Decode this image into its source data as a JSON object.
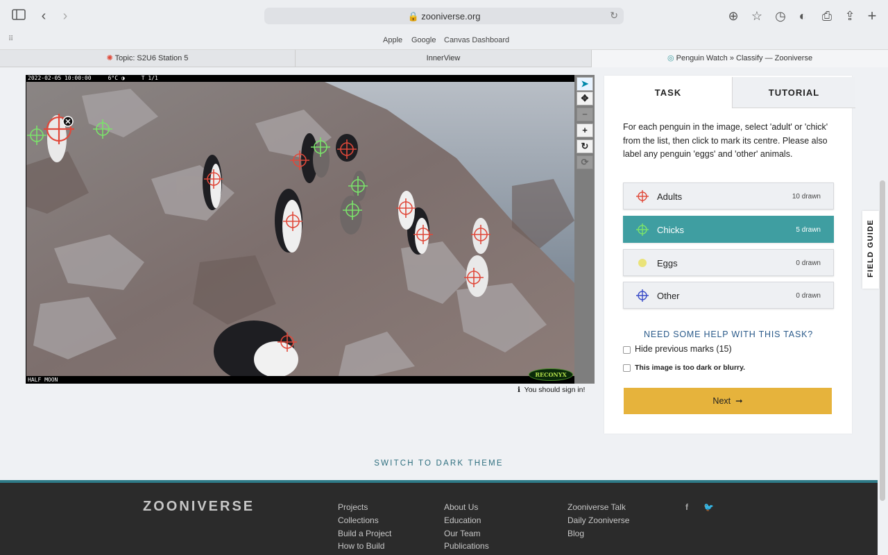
{
  "browser": {
    "url": "zooniverse.org",
    "favorites": [
      "Apple",
      "Google",
      "Canvas Dashboard"
    ],
    "tabs": [
      {
        "label": "Topic: S2U6 Station 5",
        "active": false
      },
      {
        "label": "InnerView",
        "active": false
      },
      {
        "label": "Penguin Watch » Classify — Zooniverse",
        "active": true
      }
    ]
  },
  "viewer": {
    "timestamp": "2022-02-05 10:00:00",
    "temperature": "6°C",
    "frame": "T 1/1",
    "location": "HALF MOON",
    "camera_brand": "RECONYX",
    "sign_in_notice": "You should sign in!",
    "tools": [
      "pointer-icon",
      "move-icon",
      "zoom-out-icon",
      "zoom-in-icon",
      "rotate-icon",
      "reset-icon"
    ]
  },
  "task_panel": {
    "tabs": {
      "task": "TASK",
      "tutorial": "TUTORIAL"
    },
    "instructions": "For each penguin in the image, select 'adult' or 'chick' from the list, then click to mark its centre. Please also label any penguin 'eggs' and 'other' animals.",
    "tools": [
      {
        "name": "Adults",
        "count": "10 drawn",
        "color": "#e04a3a",
        "selected": false
      },
      {
        "name": "Chicks",
        "count": "5 drawn",
        "color": "#7be36b",
        "selected": true
      },
      {
        "name": "Eggs",
        "count": "0 drawn",
        "color": "#e8e05a",
        "selected": false
      },
      {
        "name": "Other",
        "count": "0 drawn",
        "color": "#3a4cc8",
        "selected": false
      }
    ],
    "help_link": "NEED SOME HELP WITH THIS TASK?",
    "hide_marks_label": "Hide previous marks (15)",
    "dark_blurry_label": "This image is too dark or blurry.",
    "next_label": "Next"
  },
  "field_guide_label": "FIELD GUIDE",
  "dark_theme_link": "SWITCH TO DARK THEME",
  "footer": {
    "logo": "ZOONIVERSE",
    "col1": [
      "Projects",
      "Collections",
      "Build a Project",
      "How to Build"
    ],
    "col2": [
      "About Us",
      "Education",
      "Our Team",
      "Publications"
    ],
    "col3": [
      "Zooniverse Talk",
      "Daily Zooniverse",
      "Blog"
    ],
    "social": [
      "facebook-icon",
      "twitter-icon"
    ]
  },
  "marks": {
    "adults": 10,
    "chicks": 5
  },
  "colors": {
    "accent_teal": "#3f9ea1",
    "next_button": "#e6b33c",
    "adult_mark": "#e04a3a",
    "chick_mark": "#7be36b"
  }
}
